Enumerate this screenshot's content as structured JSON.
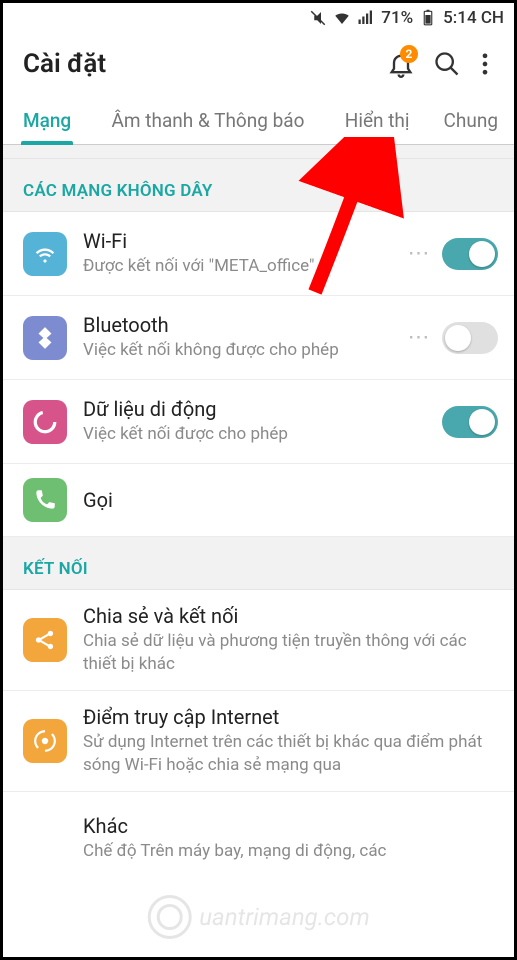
{
  "status": {
    "battery_pct": "71%",
    "time": "5:14 CH"
  },
  "header": {
    "title": "Cài đặt",
    "badge": "2"
  },
  "tabs": [
    {
      "label": "Mạng",
      "active": true
    },
    {
      "label": "Âm thanh & Thông báo",
      "active": false
    },
    {
      "label": "Hiển thị",
      "active": false
    },
    {
      "label": "Chung",
      "active": false
    }
  ],
  "sections": {
    "wireless": {
      "header": "CÁC MẠNG KHÔNG DÂY",
      "items": [
        {
          "title": "Wi-Fi",
          "subtitle": "Được kết nối với \"META_office\"",
          "icon": "wifi",
          "color": "#54b3d6",
          "has_dots": true,
          "toggle": "on"
        },
        {
          "title": "Bluetooth",
          "subtitle": "Việc kết nối không được cho phép",
          "icon": "bluetooth",
          "color": "#7d8bd0",
          "has_dots": true,
          "toggle": "off"
        },
        {
          "title": "Dữ liệu di động",
          "subtitle": "Việc kết nối được cho phép",
          "icon": "mobiledata",
          "color": "#d6548a",
          "has_dots": false,
          "toggle": "on"
        },
        {
          "title": "Gọi",
          "subtitle": "",
          "icon": "call",
          "color": "#6fbf73",
          "has_dots": false,
          "toggle": null
        }
      ]
    },
    "connect": {
      "header": "KẾT NỐI",
      "items": [
        {
          "title": "Chia sẻ và kết nối",
          "subtitle": "Chia sẻ dữ liệu và phương tiện truyền thông với các thiết bị khác",
          "icon": "share",
          "color": "#f2a63c"
        },
        {
          "title": "Điểm truy cập Internet",
          "subtitle": "Sử dụng Internet trên các thiết bị khác qua điểm phát sóng Wi-Fi hoặc chia sẻ mạng qua",
          "icon": "hotspot",
          "color": "#f2a63c"
        },
        {
          "title": "Khác",
          "subtitle": "Chế độ Trên máy bay, mạng di động, các"
        }
      ]
    }
  },
  "watermark": "uantrimang.com"
}
